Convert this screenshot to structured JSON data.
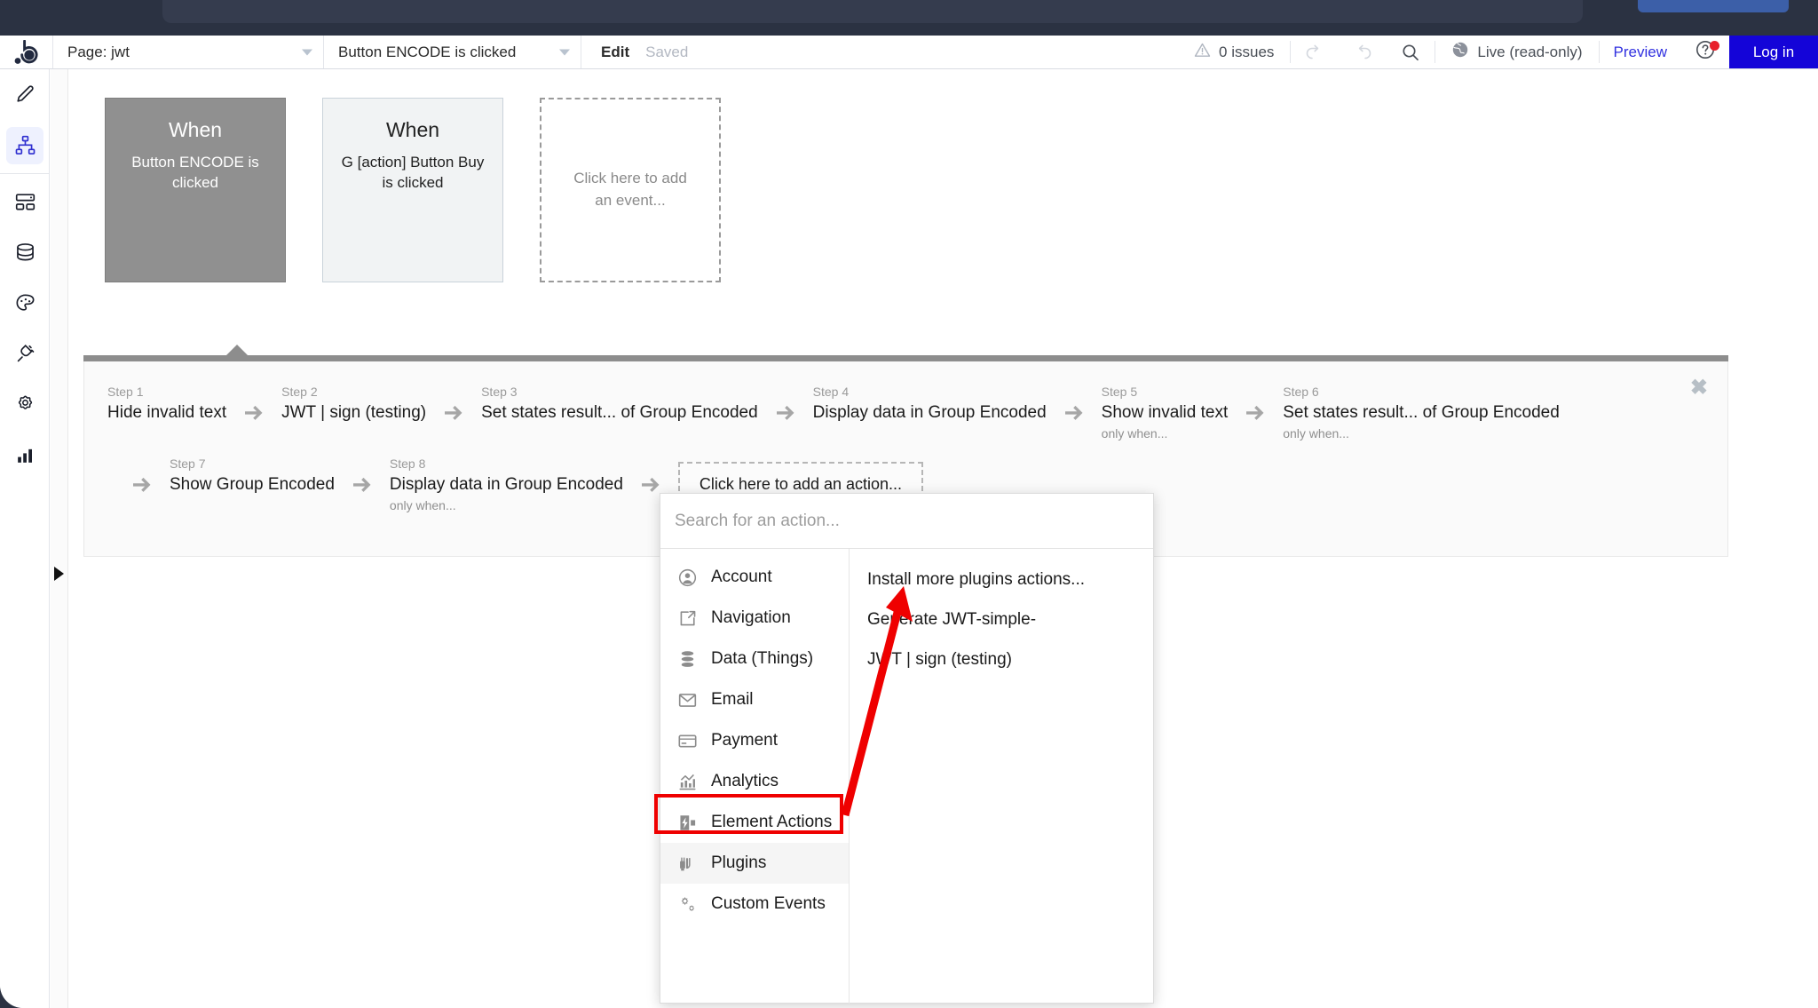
{
  "topbar": {
    "logo_icon": "bubble-logo-icon",
    "page_select": "Page: jwt",
    "event_select": "Button ENCODE is clicked",
    "edit_label": "Edit",
    "saved_label": "Saved",
    "issues_label": "0 issues",
    "issues_icon": "warning-triangle-icon",
    "undo_icon": "undo-icon",
    "redo_icon": "redo-icon",
    "search_icon": "search-icon",
    "version_icon": "globe-icon",
    "version_label": "Live (read-only)",
    "preview_label": "Preview",
    "help_icon": "question-circle-icon",
    "login_label": "Log in",
    "accent_blue": "#1404d8",
    "link_blue": "#3131e0",
    "badge_red": "#e8202a"
  },
  "rail": {
    "items": [
      {
        "icon": "pencil-design-icon",
        "active": false
      },
      {
        "icon": "workflow-hierarchy-icon",
        "active": true
      },
      {
        "icon": "data-layout-icon",
        "active": false
      },
      {
        "icon": "database-icon",
        "active": false
      },
      {
        "icon": "palette-styles-icon",
        "active": false
      },
      {
        "icon": "plug-plugins-icon",
        "active": false
      },
      {
        "icon": "gear-settings-icon",
        "active": false
      },
      {
        "icon": "bar-chart-logs-icon",
        "active": false
      }
    ],
    "active_bg": "#eef1fe"
  },
  "collapse": {
    "icon": "expand-right-arrow-icon"
  },
  "events": [
    {
      "when": "When",
      "desc": "Button ENCODE is clicked",
      "state": "selected"
    },
    {
      "when": "When",
      "desc": "G [action] Button Buy is clicked",
      "state": "normal"
    },
    {
      "placeholder": "Click here to add an event...",
      "state": "placeholder"
    }
  ],
  "workflow": {
    "close_icon": "close-x-icon",
    "steps_row1": [
      {
        "num": "Step 1",
        "title": "Hide invalid text",
        "cond": ""
      },
      {
        "num": "Step 2",
        "title": "JWT | sign (testing)",
        "cond": ""
      },
      {
        "num": "Step 3",
        "title": "Set states result... of Group Encoded",
        "cond": ""
      },
      {
        "num": "Step 4",
        "title": "Display data in Group Encoded",
        "cond": ""
      },
      {
        "num": "Step 5",
        "title": "Show invalid text",
        "cond": "only when..."
      },
      {
        "num": "Step 6",
        "title": "Set states result... of Group Encoded",
        "cond": "only when..."
      }
    ],
    "steps_row2": [
      {
        "num": "Step 7",
        "title": "Show Group Encoded",
        "cond": ""
      },
      {
        "num": "Step 8",
        "title": "Display data in Group Encoded",
        "cond": "only when..."
      }
    ],
    "add_action_label": "Click here to add an action..."
  },
  "picker": {
    "search_placeholder": "Search for an action...",
    "search_value": "",
    "categories": [
      {
        "label": "Account",
        "icon": "user-circle-icon",
        "highlight": false
      },
      {
        "label": "Navigation",
        "icon": "external-link-icon",
        "highlight": false
      },
      {
        "label": "Data (Things)",
        "icon": "database-stack-icon",
        "highlight": false
      },
      {
        "label": "Email",
        "icon": "envelope-icon",
        "highlight": false
      },
      {
        "label": "Payment",
        "icon": "credit-card-icon",
        "highlight": false
      },
      {
        "label": "Analytics",
        "icon": "analytics-chart-icon",
        "highlight": false
      },
      {
        "label": "Element Actions",
        "icon": "element-bolt-icon",
        "highlight": false
      },
      {
        "label": "Plugins",
        "icon": "plug-icon",
        "highlight": true
      },
      {
        "label": "Custom Events",
        "icon": "gears-icon",
        "highlight": false
      }
    ],
    "actions": [
      {
        "label": "Install more plugins actions..."
      },
      {
        "label": "Generate JWT-simple-"
      },
      {
        "label": "JWT | sign (testing)"
      }
    ]
  },
  "annotations": {
    "highlight_box_color": "#ef0000",
    "arrow_color": "#ef0000",
    "arrow_from": "plugins-category",
    "arrow_to": "jwt-sign-testing-action"
  }
}
